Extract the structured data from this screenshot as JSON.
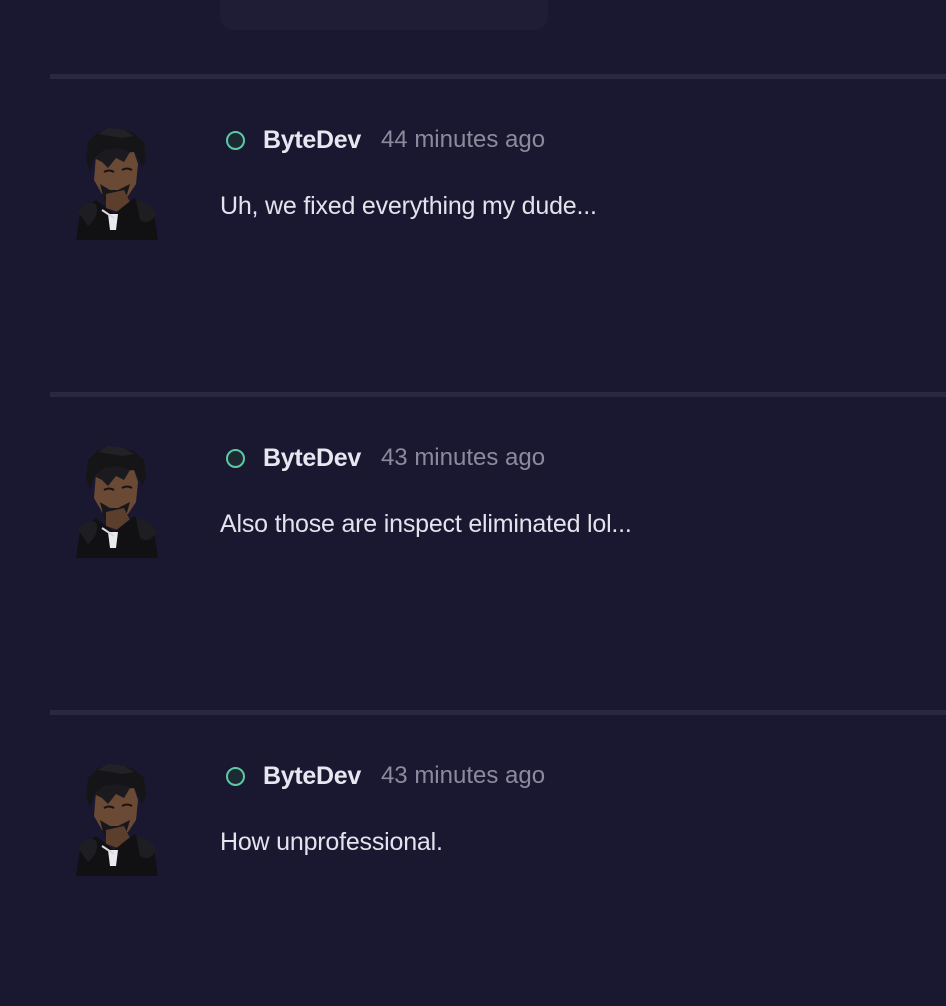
{
  "posts": [
    {
      "username": "ByteDev",
      "timestamp": "44 minutes ago",
      "message": "Uh, we fixed everything my dude...",
      "status": "online"
    },
    {
      "username": "ByteDev",
      "timestamp": "43 minutes ago",
      "message": "Also those are inspect eliminated lol...",
      "status": "online"
    },
    {
      "username": "ByteDev",
      "timestamp": "43 minutes ago",
      "message": "How unprofessional.",
      "status": "online"
    }
  ],
  "colors": {
    "background": "#1a1830",
    "divider": "#2a2840",
    "status_online": "#5fc7a4",
    "username": "#e8e6f0",
    "timestamp": "#8c8a9c"
  },
  "icons": {
    "status": "status-online-icon",
    "avatar": "user-avatar"
  }
}
